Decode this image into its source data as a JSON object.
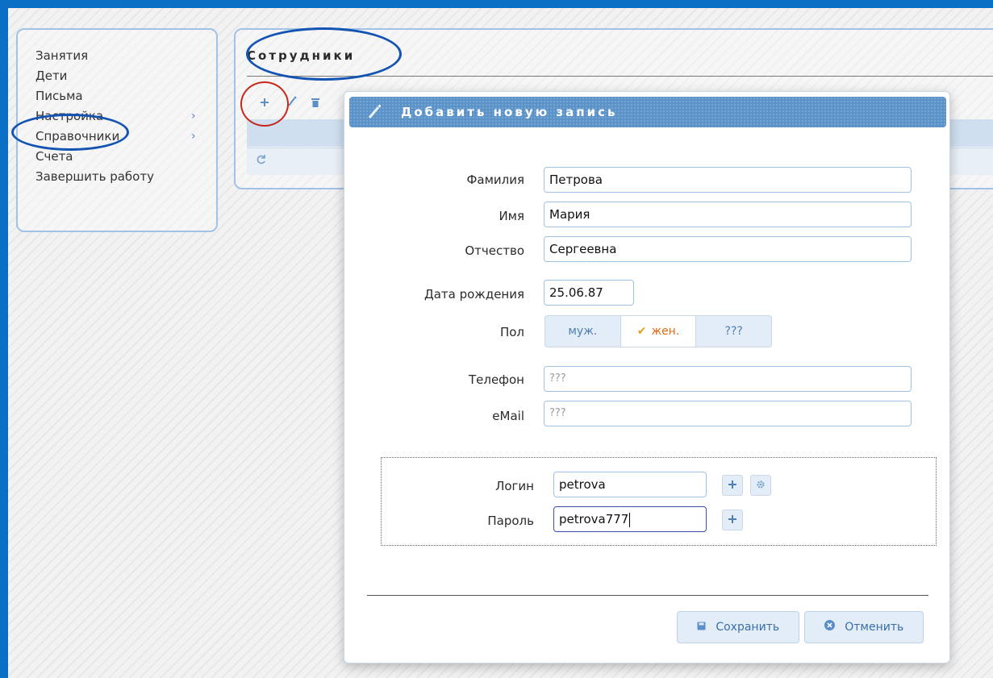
{
  "menu": {
    "items": [
      {
        "label": "Занятия"
      },
      {
        "label": "Дети"
      },
      {
        "label": "Письма"
      },
      {
        "label": "Настройка",
        "chevron": "›"
      },
      {
        "label": "Справочники",
        "chevron": "›"
      },
      {
        "label": "Счета"
      },
      {
        "label": "Завершить работу"
      }
    ]
  },
  "employees": {
    "title": "Сотрудники",
    "toolbar": {
      "add_icon": "plus-icon",
      "edit_icon": "pencil-icon",
      "delete_icon": "trash-icon"
    },
    "refresh_icon": "refresh-icon"
  },
  "dialog": {
    "title": "Добавить новую запись",
    "title_icon": "pencil-icon",
    "fields": {
      "last_name": {
        "label": "Фамилия",
        "value": "Петрова"
      },
      "first_name": {
        "label": "Имя",
        "value": "Мария"
      },
      "patronymic": {
        "label": "Отчество",
        "value": "Сергеевна"
      },
      "birth_date": {
        "label": "Дата рождения",
        "value": "25.06.87"
      },
      "gender": {
        "label": "Пол",
        "options": [
          "муж.",
          "жен.",
          "???"
        ],
        "selected": "жен."
      },
      "phone": {
        "label": "Телефон",
        "placeholder": "???"
      },
      "email": {
        "label": "eMail",
        "placeholder": "???"
      },
      "login": {
        "label": "Логин",
        "value": "petrova"
      },
      "password": {
        "label": "Пароль",
        "value": "petrova777"
      }
    },
    "buttons": {
      "save": "Сохранить",
      "cancel": "Отменить"
    }
  },
  "colors": {
    "frame": "#0b6fc6",
    "accent": "#5b93c9",
    "selected_option": "#e06a10",
    "annotation_blue": "#1354b3",
    "annotation_red": "#c6281c"
  }
}
